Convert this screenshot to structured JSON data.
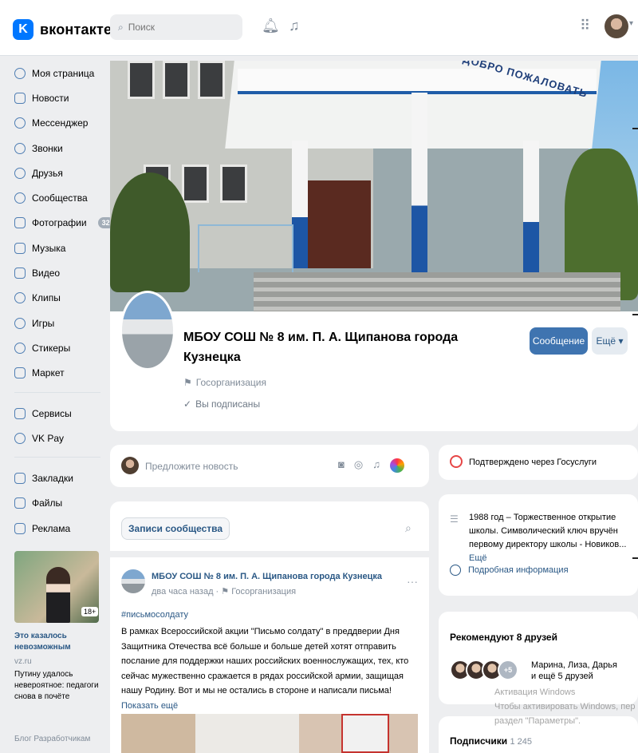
{
  "topbar": {
    "logo_mark": "K",
    "logo_text": "вконтакте",
    "search_placeholder": "Поиск",
    "bell_icon": "bell-icon",
    "music_icon": "music-icon",
    "apps_icon": "apps-grid-icon"
  },
  "sidebar": {
    "items": [
      {
        "label": "Моя страница"
      },
      {
        "label": "Новости"
      },
      {
        "label": "Мессенджер"
      },
      {
        "label": "Звонки"
      },
      {
        "label": "Друзья"
      },
      {
        "label": "Сообщества"
      },
      {
        "label": "Фотографии",
        "badge": "32"
      },
      {
        "label": "Музыка"
      },
      {
        "label": "Видео"
      },
      {
        "label": "Клипы"
      },
      {
        "label": "Игры"
      },
      {
        "label": "Стикеры"
      },
      {
        "label": "Маркет"
      }
    ],
    "items2": [
      {
        "label": "Сервисы"
      },
      {
        "label": "VK Pay"
      }
    ],
    "items3": [
      {
        "label": "Закладки"
      },
      {
        "label": "Файлы"
      },
      {
        "label": "Реклама"
      }
    ]
  },
  "ad": {
    "age": "18+",
    "title": "Это казалось невозможным",
    "domain": "vz.ru",
    "description": "Путину удалось невероятное: педагоги снова в почёте"
  },
  "footer": {
    "links": "Блог  Разработчикам"
  },
  "cover": {
    "sign": "ДОБРО ПОЖАЛОВАТЬ"
  },
  "group": {
    "title": "МБОУ СОШ № 8 им. П. А. Щипанова города Кузнецка",
    "type": "Госорганизация",
    "subscribed": "Вы подписаны",
    "message_button": "Сообщение",
    "more_button": "Ещё"
  },
  "suggest": {
    "placeholder": "Предложите новость"
  },
  "posts": {
    "tab": "Записи сообщества",
    "author": "МБОУ СОШ № 8 им. П. А. Щипанова города Кузнецка",
    "time": "два часа назад",
    "type": "Госорганизация",
    "hashtag": "#письмосолдату",
    "text": "В рамках Всероссийской акции \"Письмо солдату\" в преддверии Дня Защитника Отечества всё больше и больше детей хотят отправить послание для поддержки наших российских военнослужащих, тех, кто сейчас мужественно сражается в рядах российской армии, защищая нашу Родину. Вот и мы не остались в стороне и написали письма!",
    "show_more": "Показать ещё"
  },
  "right": {
    "gosuslugi": "Подтверждено через Госуслуги",
    "about_text": "1988 год – Торжественное открытие школы. Символический ключ вручён первому директору школы - Новиков...",
    "about_more": "Ещё",
    "info_link": "Подробная информация",
    "recommend_title": "Рекомендуют 8 друзей",
    "recommend_plus": "+5",
    "recommend_names": "Марина, Лиза, Дарья",
    "recommend_more": "и ещё 5 друзей",
    "subscribers_label": "Подписчики",
    "subscribers_count": "1 245"
  },
  "watermark": {
    "line1": "Активация Windows",
    "line2": "Чтобы активировать Windows, пер",
    "line3": "раздел \"Параметры\"."
  }
}
